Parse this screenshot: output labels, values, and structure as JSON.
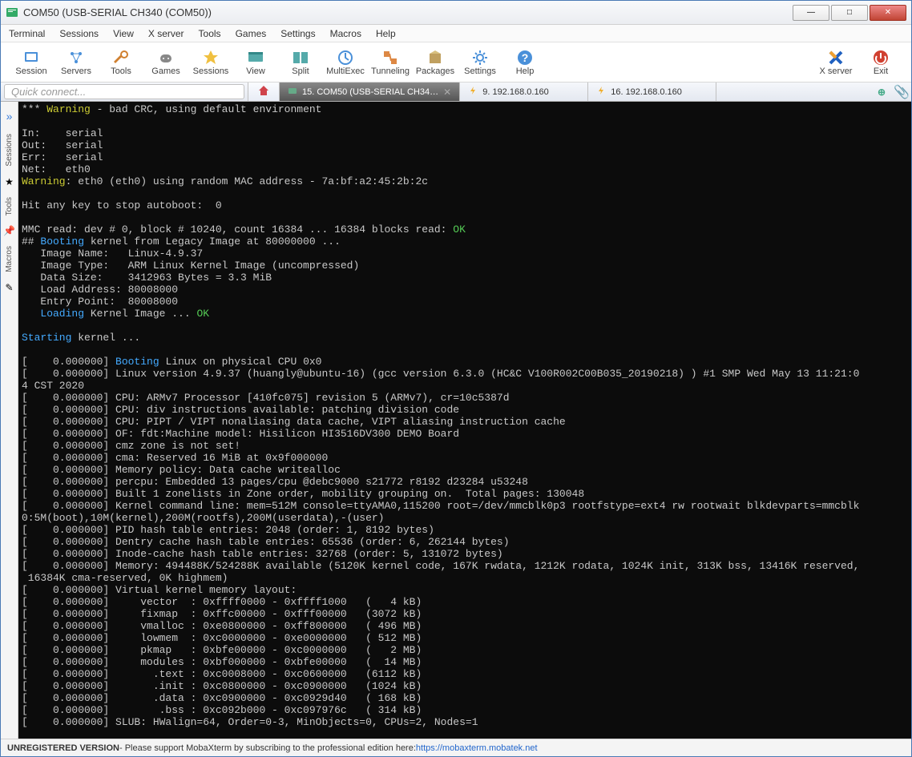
{
  "window": {
    "title": "COM50  (USB-SERIAL CH340 (COM50))"
  },
  "menubar": [
    "Terminal",
    "Sessions",
    "View",
    "X server",
    "Tools",
    "Games",
    "Settings",
    "Macros",
    "Help"
  ],
  "toolbar": [
    {
      "label": "Session",
      "icon": "session"
    },
    {
      "label": "Servers",
      "icon": "servers"
    },
    {
      "label": "Tools",
      "icon": "tools"
    },
    {
      "label": "Games",
      "icon": "games"
    },
    {
      "label": "Sessions",
      "icon": "sessions"
    },
    {
      "label": "View",
      "icon": "view"
    },
    {
      "label": "Split",
      "icon": "split"
    },
    {
      "label": "MultiExec",
      "icon": "multiexec"
    },
    {
      "label": "Tunneling",
      "icon": "tunneling"
    },
    {
      "label": "Packages",
      "icon": "packages"
    },
    {
      "label": "Settings",
      "icon": "settings"
    },
    {
      "label": "Help",
      "icon": "help"
    }
  ],
  "toolbar_right": [
    {
      "label": "X server",
      "icon": "xserver"
    },
    {
      "label": "Exit",
      "icon": "exit"
    }
  ],
  "quick_connect_placeholder": "Quick connect...",
  "tabs": [
    {
      "label": "15. COM50 (USB-SERIAL CH34…",
      "active": true,
      "icon": "serial"
    },
    {
      "label": "9. 192.168.0.160",
      "active": false,
      "icon": "lightning"
    },
    {
      "label": "16. 192.168.0.160",
      "active": false,
      "icon": "lightning"
    }
  ],
  "left_rail": {
    "tabs": [
      "Sessions",
      "Tools",
      "Macros"
    ]
  },
  "terminal_lines": [
    {
      "segs": [
        {
          "t": "*** ",
          "c": ""
        },
        {
          "t": "Warning",
          "c": "y"
        },
        {
          "t": " - bad CRC, using default environment",
          "c": ""
        }
      ]
    },
    {
      "segs": [
        {
          "t": "",
          "c": ""
        }
      ]
    },
    {
      "segs": [
        {
          "t": "In:    serial",
          "c": ""
        }
      ]
    },
    {
      "segs": [
        {
          "t": "Out:   serial",
          "c": ""
        }
      ]
    },
    {
      "segs": [
        {
          "t": "Err:   serial",
          "c": ""
        }
      ]
    },
    {
      "segs": [
        {
          "t": "Net:   eth0",
          "c": ""
        }
      ]
    },
    {
      "segs": [
        {
          "t": "Warning",
          "c": "y"
        },
        {
          "t": ": eth0 (eth0) using random MAC address - 7a:bf:a2:45:2b:2c",
          "c": ""
        }
      ]
    },
    {
      "segs": [
        {
          "t": "",
          "c": ""
        }
      ]
    },
    {
      "segs": [
        {
          "t": "Hit any key to stop autoboot:  0",
          "c": ""
        }
      ]
    },
    {
      "segs": [
        {
          "t": "",
          "c": ""
        }
      ]
    },
    {
      "segs": [
        {
          "t": "MMC read: dev # 0, block # 10240, count 16384 ... 16384 blocks read: ",
          "c": ""
        },
        {
          "t": "OK",
          "c": "g"
        }
      ]
    },
    {
      "segs": [
        {
          "t": "## ",
          "c": ""
        },
        {
          "t": "Booting",
          "c": "b"
        },
        {
          "t": " kernel from Legacy Image at 80000000 ...",
          "c": ""
        }
      ]
    },
    {
      "segs": [
        {
          "t": "   Image Name:   Linux-4.9.37",
          "c": ""
        }
      ]
    },
    {
      "segs": [
        {
          "t": "   Image Type:   ARM Linux Kernel Image (uncompressed)",
          "c": ""
        }
      ]
    },
    {
      "segs": [
        {
          "t": "   Data Size:    3412963 Bytes = 3.3 MiB",
          "c": ""
        }
      ]
    },
    {
      "segs": [
        {
          "t": "   Load Address: 80008000",
          "c": ""
        }
      ]
    },
    {
      "segs": [
        {
          "t": "   Entry Point:  80008000",
          "c": ""
        }
      ]
    },
    {
      "segs": [
        {
          "t": "   ",
          "c": ""
        },
        {
          "t": "Loading",
          "c": "b"
        },
        {
          "t": " Kernel Image ... ",
          "c": ""
        },
        {
          "t": "OK",
          "c": "g"
        }
      ]
    },
    {
      "segs": [
        {
          "t": "",
          "c": ""
        }
      ]
    },
    {
      "segs": [
        {
          "t": "Starting",
          "c": "b"
        },
        {
          "t": " kernel ...",
          "c": ""
        }
      ]
    },
    {
      "segs": [
        {
          "t": "",
          "c": ""
        }
      ]
    },
    {
      "segs": [
        {
          "t": "[    0.000000] ",
          "c": ""
        },
        {
          "t": "Booting",
          "c": "b"
        },
        {
          "t": " Linux on physical CPU 0x0",
          "c": ""
        }
      ]
    },
    {
      "segs": [
        {
          "t": "[    0.000000] Linux version 4.9.37 (huangly@ubuntu-16) (gcc version 6.3.0 (HC&C V100R002C00B035_20190218) ) #1 SMP Wed May 13 11:21:0",
          "c": ""
        }
      ]
    },
    {
      "segs": [
        {
          "t": "4 CST 2020",
          "c": ""
        }
      ]
    },
    {
      "segs": [
        {
          "t": "[    0.000000] CPU: ARMv7 Processor [410fc075] revision 5 (ARMv7), cr=10c5387d",
          "c": ""
        }
      ]
    },
    {
      "segs": [
        {
          "t": "[    0.000000] CPU: div instructions available: patching division code",
          "c": ""
        }
      ]
    },
    {
      "segs": [
        {
          "t": "[    0.000000] CPU: PIPT / VIPT nonaliasing data cache, VIPT aliasing instruction cache",
          "c": ""
        }
      ]
    },
    {
      "segs": [
        {
          "t": "[    0.000000] OF: fdt:Machine model: Hisilicon HI3516DV300 DEMO Board",
          "c": ""
        }
      ]
    },
    {
      "segs": [
        {
          "t": "[    0.000000] cmz zone is not set!",
          "c": ""
        }
      ]
    },
    {
      "segs": [
        {
          "t": "[    0.000000] cma: Reserved 16 MiB at 0x9f000000",
          "c": ""
        }
      ]
    },
    {
      "segs": [
        {
          "t": "[    0.000000] Memory policy: Data cache writealloc",
          "c": ""
        }
      ]
    },
    {
      "segs": [
        {
          "t": "[    0.000000] percpu: Embedded 13 pages/cpu @debc9000 s21772 r8192 d23284 u53248",
          "c": ""
        }
      ]
    },
    {
      "segs": [
        {
          "t": "[    0.000000] Built 1 zonelists in Zone order, mobility grouping on.  Total pages: 130048",
          "c": ""
        }
      ]
    },
    {
      "segs": [
        {
          "t": "[    0.000000] Kernel command line: mem=512M console=ttyAMA0,115200 root=/dev/mmcblk0p3 rootfstype=ext4 rw rootwait blkdevparts=mmcblk",
          "c": ""
        }
      ]
    },
    {
      "segs": [
        {
          "t": "0:5M(boot),10M(kernel),200M(rootfs),200M(userdata),-(user)",
          "c": ""
        }
      ]
    },
    {
      "segs": [
        {
          "t": "[    0.000000] PID hash table entries: 2048 (order: 1, 8192 bytes)",
          "c": ""
        }
      ]
    },
    {
      "segs": [
        {
          "t": "[    0.000000] Dentry cache hash table entries: 65536 (order: 6, 262144 bytes)",
          "c": ""
        }
      ]
    },
    {
      "segs": [
        {
          "t": "[    0.000000] Inode-cache hash table entries: 32768 (order: 5, 131072 bytes)",
          "c": ""
        }
      ]
    },
    {
      "segs": [
        {
          "t": "[    0.000000] Memory: 494488K/524288K available (5120K kernel code, 167K rwdata, 1212K rodata, 1024K init, 313K bss, 13416K reserved,",
          "c": ""
        }
      ]
    },
    {
      "segs": [
        {
          "t": " 16384K cma-reserved, 0K highmem)",
          "c": ""
        }
      ]
    },
    {
      "segs": [
        {
          "t": "[    0.000000] Virtual kernel memory layout:",
          "c": ""
        }
      ]
    },
    {
      "segs": [
        {
          "t": "[    0.000000]     vector  : 0xffff0000 - 0xffff1000   (   4 kB)",
          "c": ""
        }
      ]
    },
    {
      "segs": [
        {
          "t": "[    0.000000]     fixmap  : 0xffc00000 - 0xfff00000   (3072 kB)",
          "c": ""
        }
      ]
    },
    {
      "segs": [
        {
          "t": "[    0.000000]     vmalloc : 0xe0800000 - 0xff800000   ( 496 MB)",
          "c": ""
        }
      ]
    },
    {
      "segs": [
        {
          "t": "[    0.000000]     lowmem  : 0xc0000000 - 0xe0000000   ( 512 MB)",
          "c": ""
        }
      ]
    },
    {
      "segs": [
        {
          "t": "[    0.000000]     pkmap   : 0xbfe00000 - 0xc0000000   (   2 MB)",
          "c": ""
        }
      ]
    },
    {
      "segs": [
        {
          "t": "[    0.000000]     modules : 0xbf000000 - 0xbfe00000   (  14 MB)",
          "c": ""
        }
      ]
    },
    {
      "segs": [
        {
          "t": "[    0.000000]       .text : 0xc0008000 - 0xc0600000   (6112 kB)",
          "c": ""
        }
      ]
    },
    {
      "segs": [
        {
          "t": "[    0.000000]       .init : 0xc0800000 - 0xc0900000   (1024 kB)",
          "c": ""
        }
      ]
    },
    {
      "segs": [
        {
          "t": "[    0.000000]       .data : 0xc0900000 - 0xc0929d40   ( 168 kB)",
          "c": ""
        }
      ]
    },
    {
      "segs": [
        {
          "t": "[    0.000000]        .bss : 0xc092b000 - 0xc097976c   ( 314 kB)",
          "c": ""
        }
      ]
    },
    {
      "segs": [
        {
          "t": "[    0.000000] SLUB: HWalign=64, Order=0-3, MinObjects=0, CPUs=2, Nodes=1",
          "c": ""
        }
      ]
    }
  ],
  "statusbar": {
    "prefix": "UNREGISTERED VERSION",
    "text": "  -  Please support MobaXterm by subscribing to the professional edition here:  ",
    "link": "https://mobaxterm.mobatek.net"
  }
}
